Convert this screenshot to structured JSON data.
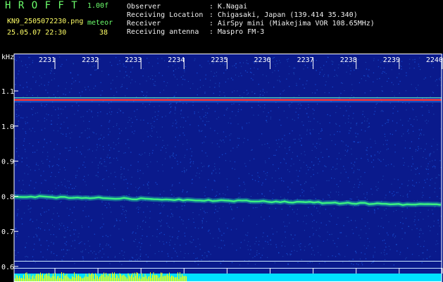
{
  "header": {
    "app_title": "H R O F F T",
    "version": "1.00f",
    "file_name": "KN9_2505072230.png",
    "datetime": "25.05.07 22:30",
    "meteor_label": "meteor",
    "meteor_count": "38",
    "info": [
      {
        "label": "Observer",
        "value": ": K.Nagai"
      },
      {
        "label": "Receiving Location",
        "value": ": Chigasaki, Japan (139.414 35.340)"
      },
      {
        "label": "Receiver",
        "value": ": AirSpy mini (Miakejima VOR 108.65MHz)"
      },
      {
        "label": "Receiving antenna",
        "value": ": Maspro FM-3"
      }
    ]
  },
  "spectrogram": {
    "y_unit": "kHz",
    "y_ticks": [
      "1.1",
      "1.0",
      "0.9",
      "0.8",
      "0.7",
      "0.6"
    ],
    "time_ticks": [
      "2231",
      "2232",
      "2233",
      "2234",
      "2235",
      "2236",
      "2237",
      "2238",
      "2239",
      "2240"
    ],
    "colors": {
      "background": "#0a1a8c",
      "noise": "#1e6cff",
      "strong": "#ff3030",
      "trace": "#40ff80",
      "baseline": "#00e0ff",
      "meteor_bar": "#ffff00"
    }
  }
}
